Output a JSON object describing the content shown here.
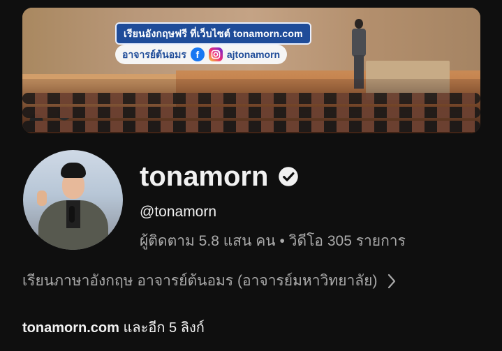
{
  "banner": {
    "line1": "เรียนอังกฤษฟรี ที่เว็บไซต์ tonamorn.com",
    "line2_name": "อาจารย์ต้นอมร",
    "line2_fb": "f",
    "line2_handle": "ajtonamorn",
    "icons": [
      "facebook-icon",
      "instagram-icon"
    ]
  },
  "channel": {
    "name": "tonamorn",
    "handle": "@tonamorn",
    "stats": "ผู้ติดตาม 5.8 แสน คน • วิดีโอ 305 รายการ",
    "description": "เรียนภาษาอังกฤษ อาจารย์ต้นอมร (อาจารย์มหาวิทยาลัย)",
    "links_domain": "tonamorn.com",
    "links_more": " และอีก 5 ลิงก์"
  },
  "colors": {
    "background": "#0f0f0f",
    "text_primary": "#f1f1f1",
    "text_secondary": "#aaaaaa",
    "banner_tag": "#1f4c99"
  }
}
